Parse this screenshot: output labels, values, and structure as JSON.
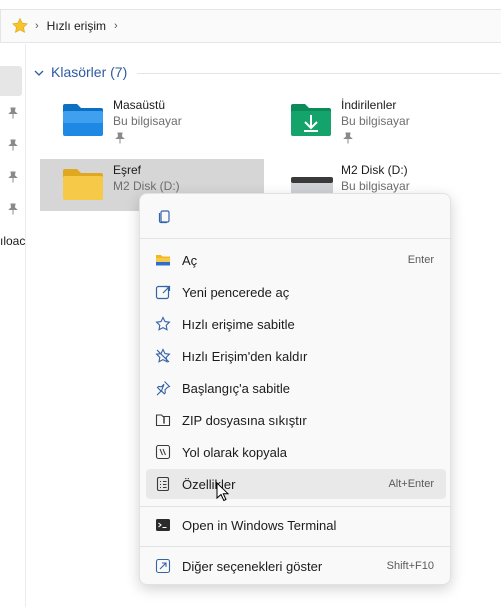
{
  "address_bar": {
    "icon": "star-icon",
    "location": "Hızlı erişim"
  },
  "nav": {
    "partial_label": "ıloac"
  },
  "group": {
    "title": "Klasörler (7)"
  },
  "tiles": [
    {
      "name": "Masaüstü",
      "sub": "Bu bilgisayar",
      "icon": "desktop-folder-icon",
      "pinned": true
    },
    {
      "name": "İndirilenler",
      "sub": "Bu bilgisayar",
      "icon": "downloads-folder-icon",
      "pinned": true
    },
    {
      "name": "Eşref",
      "sub": "M2 Disk (D:)",
      "icon": "folder-icon",
      "pinned": false,
      "selected": true
    },
    {
      "name": "M2 Disk (D:)",
      "sub": "Bu bilgisayar",
      "icon": "drive-icon",
      "pinned": true
    }
  ],
  "context_menu": {
    "top_action_icon": "copy-icon",
    "items": [
      {
        "label": "Aç",
        "shortcut": "Enter",
        "icon": "open-folder-icon"
      },
      {
        "label": "Yeni pencerede aç",
        "shortcut": "",
        "icon": "new-window-icon"
      },
      {
        "label": "Hızlı erişime sabitle",
        "shortcut": "",
        "icon": "star-outline-icon"
      },
      {
        "label": "Hızlı Erişim'den kaldır",
        "shortcut": "",
        "icon": "unstar-icon"
      },
      {
        "label": "Başlangıç'a sabitle",
        "shortcut": "",
        "icon": "pin-icon"
      },
      {
        "label": "ZIP dosyasına sıkıştır",
        "shortcut": "",
        "icon": "zip-icon"
      },
      {
        "label": "Yol olarak kopyala",
        "shortcut": "",
        "icon": "copy-path-icon"
      },
      {
        "label": "Özellikler",
        "shortcut": "Alt+Enter",
        "icon": "properties-icon"
      },
      {
        "label": "Open in Windows Terminal",
        "shortcut": "",
        "icon": "terminal-icon"
      },
      {
        "label": "Diğer seçenekleri göster",
        "shortcut": "Shift+F10",
        "icon": "more-options-icon"
      }
    ]
  },
  "colors": {
    "accent": "#0067c0",
    "group_title": "#2d5aa0",
    "folder_yellow": "#f7c948",
    "desktop_blue": "#1e88e5",
    "downloads_green": "#13a36b"
  }
}
